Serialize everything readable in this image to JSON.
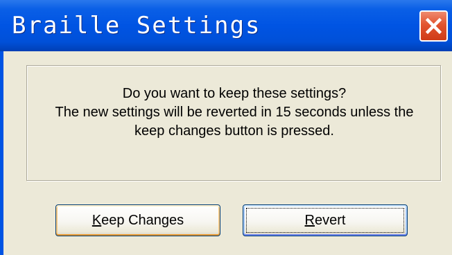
{
  "window": {
    "title": "Braille Settings"
  },
  "titlebar": {
    "close_icon": "close-icon",
    "close_color": "#e2542f",
    "title_color": "#0054e3"
  },
  "message": {
    "lines": [
      "Do you want to keep these settings?",
      "The new settings will be reverted in 15 seconds unless the",
      "keep changes button is pressed."
    ]
  },
  "buttons": {
    "keep": {
      "mnemonic": "K",
      "rest": "eep Changes",
      "state": "default"
    },
    "revert": {
      "mnemonic": "R",
      "rest": "evert",
      "state": "focused"
    }
  }
}
